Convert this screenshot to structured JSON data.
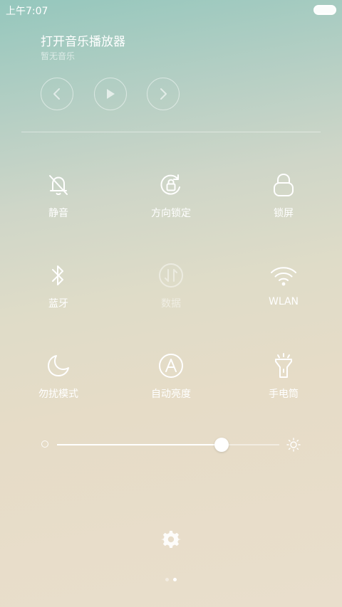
{
  "status_bar": {
    "time": "上午7:07",
    "battery_icon": "battery-icon"
  },
  "music": {
    "title": "打开音乐播放器",
    "subtitle": "暂无音乐",
    "controls": [
      "previous-icon",
      "play-icon",
      "next-icon"
    ]
  },
  "tiles": [
    {
      "label": "静音",
      "icon": "bell-off-icon",
      "enabled": true
    },
    {
      "label": "方向锁定",
      "icon": "rotation-lock-icon",
      "enabled": true
    },
    {
      "label": "锁屏",
      "icon": "lock-icon",
      "enabled": true
    },
    {
      "label": "蓝牙",
      "icon": "bluetooth-icon",
      "enabled": true
    },
    {
      "label": "数据",
      "icon": "mobile-data-icon",
      "enabled": false
    },
    {
      "label": "WLAN",
      "icon": "wifi-icon",
      "enabled": true
    },
    {
      "label": "勿扰模式",
      "icon": "moon-icon",
      "enabled": true
    },
    {
      "label": "自动亮度",
      "icon": "auto-brightness-icon",
      "enabled": true
    },
    {
      "label": "手电筒",
      "icon": "flashlight-icon",
      "enabled": true
    }
  ],
  "brightness": {
    "level_percent": 74
  },
  "pager": {
    "count": 2,
    "active_index": 1
  },
  "colors": {
    "foreground": "#ffffff",
    "background_top": "#95c7bd",
    "background_bottom": "#e9decc"
  }
}
